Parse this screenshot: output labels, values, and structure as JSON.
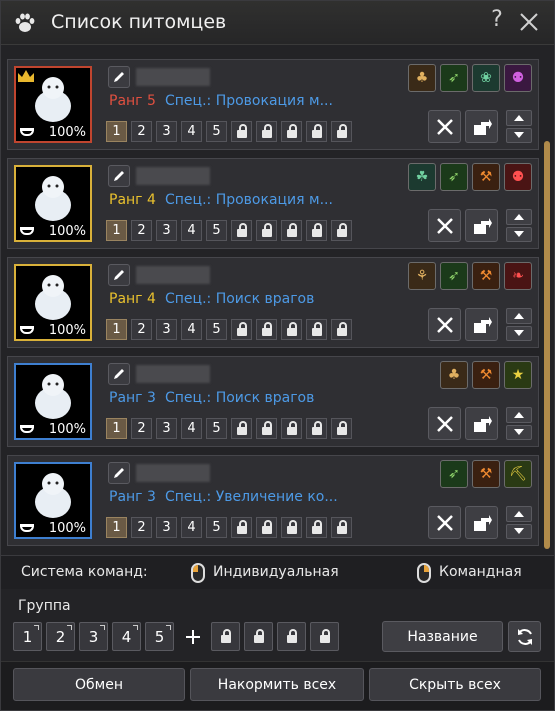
{
  "window": {
    "title": "Список питомцев",
    "help_label": "?",
    "close_label": "close"
  },
  "slot_numbers": [
    "1",
    "2",
    "3",
    "4",
    "5"
  ],
  "pets": [
    {
      "rank_text": "Ранг 5",
      "rank_color": "red",
      "spec_text": "Спец.: Провокация м...",
      "loyalty": "100%",
      "frame_color": "#c0452f",
      "skills": [
        "sk-brown",
        "sk-green",
        "sk-feather",
        "sk-purple"
      ],
      "skill_icons": [
        "scorpion-icon",
        "hunt-icon",
        "feather-icon",
        "group-icon"
      ]
    },
    {
      "rank_text": "Ранг 4",
      "rank_color": "yellow",
      "spec_text": "Спец.: Провокация м...",
      "loyalty": "100%",
      "frame_color": "#d9b13a",
      "skills": [
        "sk-feather",
        "sk-green",
        "sk-orange",
        "sk-red"
      ],
      "skill_icons": [
        "clover-icon",
        "hunt-icon",
        "axe-icon",
        "group-icon"
      ]
    },
    {
      "rank_text": "Ранг 4",
      "rank_color": "yellow",
      "spec_text": "Спец.: Поиск врагов",
      "loyalty": "100%",
      "frame_color": "#d9b13a",
      "skills": [
        "sk-brown",
        "sk-green",
        "sk-orange",
        "sk-red"
      ],
      "skill_icons": [
        "wheat-icon",
        "hunt-icon",
        "axe-icon",
        "horn-icon"
      ]
    },
    {
      "rank_text": "Ранг 3",
      "rank_color": "blue",
      "spec_text": "Спец.: Поиск врагов",
      "loyalty": "100%",
      "frame_color": "#3e7fd0",
      "skills": [
        "sk-brown",
        "sk-orange",
        "sk-gold"
      ],
      "skill_icons": [
        "scorpion-icon",
        "axe-icon",
        "runner-icon"
      ]
    },
    {
      "rank_text": "Ранг 3",
      "rank_color": "blue",
      "spec_text": "Спец.: Увеличение ко...",
      "loyalty": "100%",
      "frame_color": "#3e7fd0",
      "skills": [
        "sk-green",
        "sk-orange",
        "sk-gold"
      ],
      "skill_icons": [
        "hunt-icon",
        "axe-icon",
        "pickaxe-icon"
      ]
    }
  ],
  "command": {
    "label": "Система команд:",
    "individual": "Индивидуальная",
    "team": "Командная"
  },
  "group": {
    "label": "Группа",
    "slots": [
      "1",
      "2",
      "3",
      "4",
      "5"
    ],
    "name_button": "Название"
  },
  "bottom": {
    "exchange": "Обмен",
    "feed_all": "Накормить всех",
    "hide_all": "Скрыть всех"
  }
}
